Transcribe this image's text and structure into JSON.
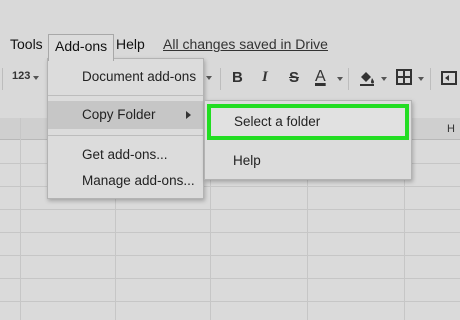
{
  "menubar": {
    "tools": "Tools",
    "addons": "Add-ons",
    "help": "Help",
    "saved_status": "All changes saved in Drive"
  },
  "toolbar": {
    "number_format": "123",
    "bold": "B",
    "italic": "I",
    "strikethrough": "S",
    "text_color": "A"
  },
  "grid": {
    "column_h": "H"
  },
  "addons_menu": {
    "items": [
      {
        "label": "Document add-ons"
      },
      {
        "label": "Copy Folder"
      },
      {
        "label": "Get add-ons..."
      },
      {
        "label": "Manage add-ons..."
      }
    ]
  },
  "copy_folder_submenu": {
    "items": [
      {
        "label": "Select a folder"
      },
      {
        "label": "Help"
      }
    ]
  },
  "colors": {
    "highlight": "#22dd22",
    "background": "#d9d9d9"
  }
}
